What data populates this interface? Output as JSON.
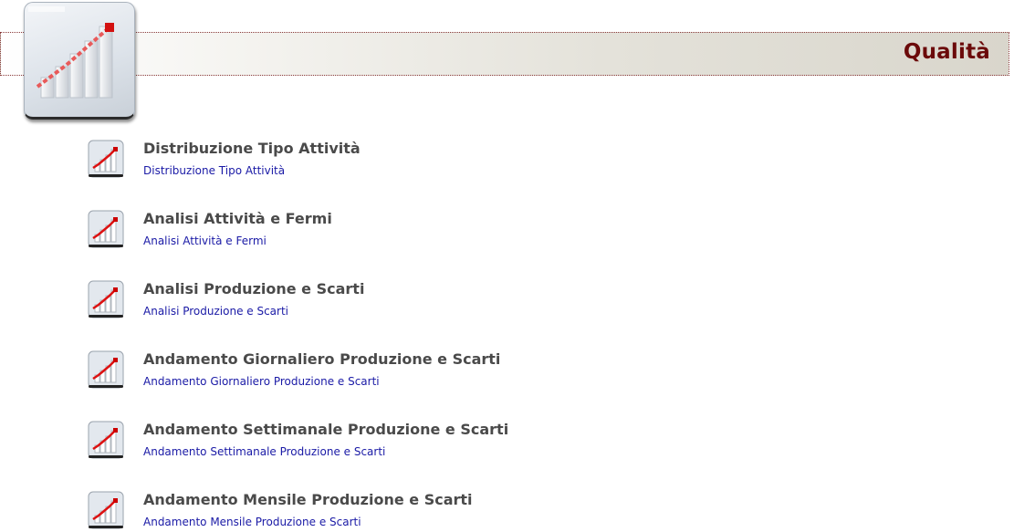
{
  "header": {
    "title": "Qualità",
    "logo_icon": "bar-chart-icon"
  },
  "colors": {
    "title": "#6b0a0a",
    "item_title": "#4a4a4a",
    "link": "#1a1aa6"
  },
  "items": [
    {
      "title": "Distribuzione Tipo Attività",
      "link": "Distribuzione Tipo Attività",
      "icon": "bar-chart-icon"
    },
    {
      "title": "Analisi Attività e Fermi",
      "link": "Analisi Attività e Fermi",
      "icon": "bar-chart-icon"
    },
    {
      "title": "Analisi Produzione e Scarti",
      "link": "Analisi Produzione e Scarti",
      "icon": "bar-chart-icon"
    },
    {
      "title": "Andamento Giornaliero Produzione e Scarti",
      "link": "Andamento Giornaliero Produzione e Scarti",
      "icon": "bar-chart-icon"
    },
    {
      "title": "Andamento Settimanale Produzione e Scarti",
      "link": "Andamento Settimanale Produzione e Scarti",
      "icon": "bar-chart-icon"
    },
    {
      "title": "Andamento Mensile Produzione e Scarti",
      "link": "Andamento Mensile Produzione e Scarti",
      "icon": "bar-chart-icon"
    }
  ]
}
